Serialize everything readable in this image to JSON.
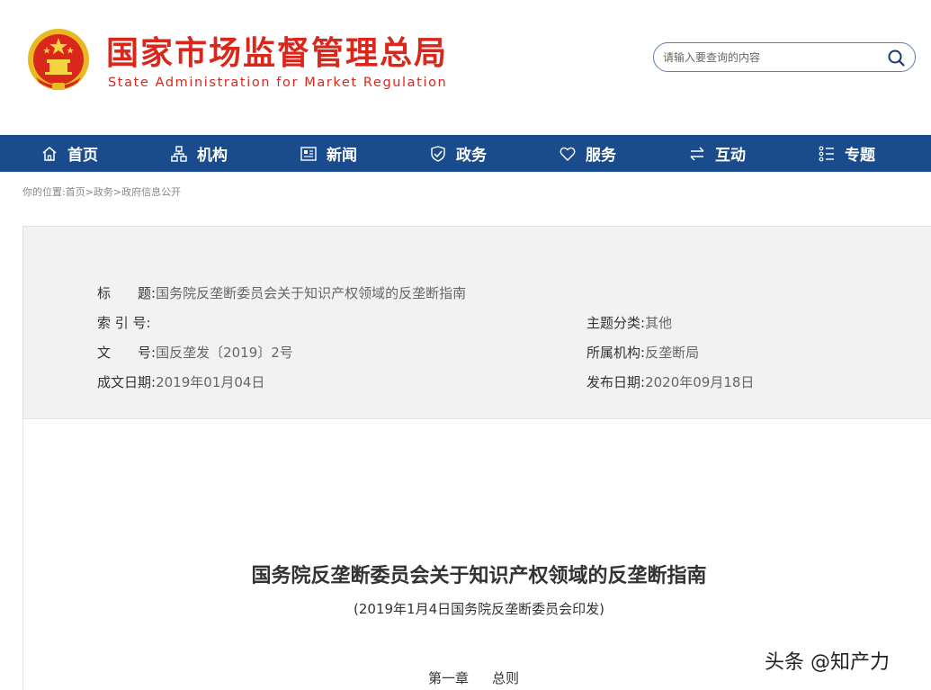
{
  "header": {
    "title": "国家市场监督管理总局",
    "subtitle": "State Administration for Market Regulation",
    "search": {
      "placeholder": "请输入要查询的内容",
      "icon": "search-icon"
    }
  },
  "nav": {
    "items": [
      {
        "label": "首页",
        "icon": "home-icon"
      },
      {
        "label": "机构",
        "icon": "org-chart-icon"
      },
      {
        "label": "新闻",
        "icon": "newspaper-icon"
      },
      {
        "label": "政务",
        "icon": "shield-icon"
      },
      {
        "label": "服务",
        "icon": "heart-icon"
      },
      {
        "label": "互动",
        "icon": "exchange-icon"
      },
      {
        "label": "专题",
        "icon": "list-icon"
      }
    ]
  },
  "breadcrumb": "你的位置:首页>政务>政府信息公开",
  "meta": {
    "title_label": "标　　题:",
    "title_value": "国务院反垄断委员会关于知识产权领域的反垄断指南",
    "index_label": "索 引 号:",
    "index_value": "",
    "topic_label": "主题分类:",
    "topic_value": "其他",
    "docno_label": "文　　号:",
    "docno_value": "国反垄发〔2019〕2号",
    "agency_label": "所属机构:",
    "agency_value": "反垄断局",
    "created_label": "成文日期:",
    "created_value": "2019年01月04日",
    "published_label": "发布日期:",
    "published_value": "2020年09月18日"
  },
  "document": {
    "title": "国务院反垄断委员会关于知识产权领域的反垄断指南",
    "subtitle": "(2019年1月4日国务院反垄断委员会印发)",
    "chapter_number": "第一章",
    "chapter_title": "总则"
  },
  "watermark": "头条 @知产力",
  "colors": {
    "brand_red": "#d9271b",
    "nav_blue": "#1a4b8c"
  }
}
